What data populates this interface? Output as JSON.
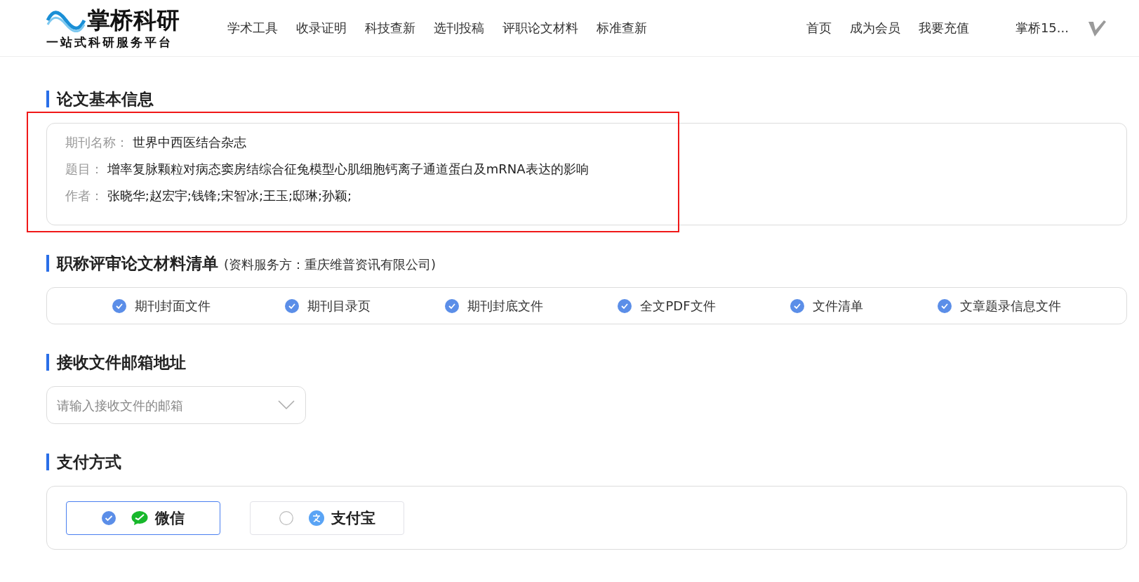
{
  "header": {
    "logo": {
      "title": "掌桥科研",
      "slogan": "一站式科研服务平台"
    },
    "nav": [
      "学术工具",
      "收录证明",
      "科技查新",
      "选刊投稿",
      "评职论文材料",
      "标准查新"
    ],
    "links": [
      "首页",
      "成为会员",
      "我要充值"
    ],
    "user": "掌桥15..."
  },
  "paper_info": {
    "title": "论文基本信息",
    "highlighted": true,
    "fields": [
      {
        "label": "期刊名称：",
        "value": "世界中西医结合杂志"
      },
      {
        "label": "题目：",
        "value": "增率复脉颗粒对病态窦房结综合征兔模型心肌细胞钙离子通道蛋白及mRNA表达的影响"
      },
      {
        "label": "作者：",
        "value": "张晓华;赵宏宇;钱锋;宋智冰;王玉;邸琳;孙颖;"
      }
    ]
  },
  "materials": {
    "title": "职称评审论文材料清单",
    "note": "(资料服务方：重庆维普资讯有限公司)",
    "items": [
      {
        "label": "期刊封面文件",
        "checked": true
      },
      {
        "label": "期刊目录页",
        "checked": true
      },
      {
        "label": "期刊封底文件",
        "checked": true
      },
      {
        "label": "全文PDF文件",
        "checked": true
      },
      {
        "label": "文件清单",
        "checked": true
      },
      {
        "label": "文章题录信息文件",
        "checked": true
      }
    ]
  },
  "email": {
    "title": "接收文件邮箱地址",
    "placeholder": "请输入接收文件的邮箱"
  },
  "payment": {
    "title": "支付方式",
    "options": [
      {
        "kind": "wechat",
        "label": "微信",
        "selected": true
      },
      {
        "kind": "alipay",
        "label": "支付宝",
        "selected": false
      }
    ]
  }
}
